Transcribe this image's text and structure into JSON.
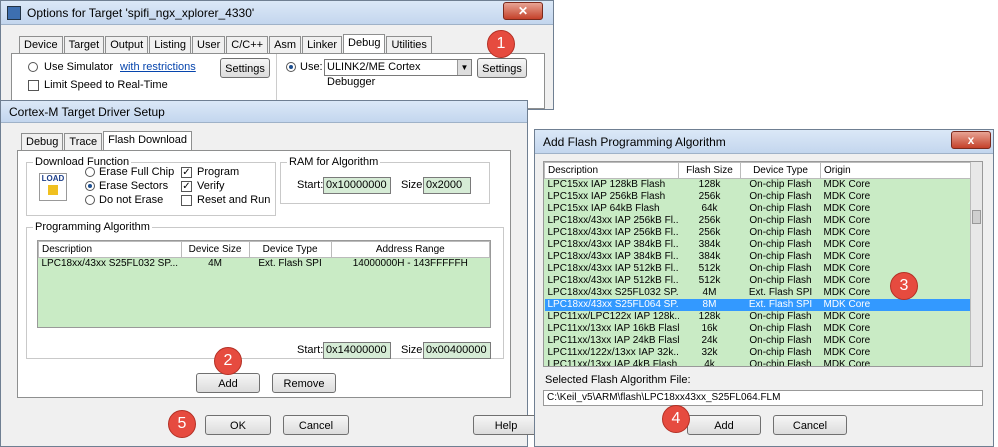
{
  "options_window": {
    "title": "Options for Target 'spifi_ngx_xplorer_4330'",
    "tabs": [
      "Device",
      "Target",
      "Output",
      "Listing",
      "User",
      "C/C++",
      "Asm",
      "Linker",
      "Debug",
      "Utilities"
    ],
    "active_tab": "Debug",
    "use_simulator_label": "Use Simulator",
    "with_restrictions_link": "with restrictions",
    "settings_left_label": "Settings",
    "limit_speed_label": "Limit Speed to Real-Time",
    "use_label": "Use:",
    "debugger_value": "ULINK2/ME Cortex Debugger",
    "settings_right_label": "Settings"
  },
  "driver_window": {
    "title": "Cortex-M Target Driver Setup",
    "tabs": [
      "Debug",
      "Trace",
      "Flash Download"
    ],
    "active_tab": "Flash Download",
    "download_function_label": "Download Function",
    "load_icon_text": "LOAD",
    "erase_full_chip": "Erase Full Chip",
    "erase_sectors": "Erase Sectors",
    "do_not_erase": "Do not Erase",
    "program": "Program",
    "verify": "Verify",
    "reset_and_run": "Reset and Run",
    "ram_label": "RAM for Algorithm",
    "ram_start_label": "Start:",
    "ram_start": "0x10000000",
    "ram_size_label": "Size:",
    "ram_size": "0x2000",
    "prog_algo_label": "Programming Algorithm",
    "columns": [
      "Description",
      "Device Size",
      "Device Type",
      "Address Range"
    ],
    "rows": [
      [
        "LPC18xx/43xx S25FL032 SP...",
        "4M",
        "Ext. Flash SPI",
        "14000000H - 143FFFFFH"
      ]
    ],
    "algo_start_label": "Start:",
    "algo_start": "0x14000000",
    "algo_size_label": "Size:",
    "algo_size": "0x00400000",
    "add_label": "Add",
    "remove_label": "Remove",
    "ok_label": "OK",
    "cancel_label": "Cancel",
    "help_label": "Help"
  },
  "add_window": {
    "title": "Add Flash Programming Algorithm",
    "columns": [
      "Description",
      "Flash Size",
      "Device Type",
      "Origin"
    ],
    "rows": [
      [
        "LPC15xx IAP 128kB Flash",
        "128k",
        "On-chip Flash",
        "MDK Core"
      ],
      [
        "LPC15xx IAP 256kB Flash",
        "256k",
        "On-chip Flash",
        "MDK Core"
      ],
      [
        "LPC15xx IAP 64kB Flash",
        "64k",
        "On-chip Flash",
        "MDK Core"
      ],
      [
        "LPC18xx/43xx IAP 256kB Fl...",
        "256k",
        "On-chip Flash",
        "MDK Core"
      ],
      [
        "LPC18xx/43xx IAP 256kB Fl...",
        "256k",
        "On-chip Flash",
        "MDK Core"
      ],
      [
        "LPC18xx/43xx IAP 384kB Fl...",
        "384k",
        "On-chip Flash",
        "MDK Core"
      ],
      [
        "LPC18xx/43xx IAP 384kB Fl...",
        "384k",
        "On-chip Flash",
        "MDK Core"
      ],
      [
        "LPC18xx/43xx IAP 512kB Fl...",
        "512k",
        "On-chip Flash",
        "MDK Core"
      ],
      [
        "LPC18xx/43xx IAP 512kB Fl...",
        "512k",
        "On-chip Flash",
        "MDK Core"
      ],
      [
        "LPC18xx/43xx S25FL032 SP...",
        "4M",
        "Ext. Flash SPI",
        "MDK Core"
      ],
      [
        "LPC18xx/43xx S25FL064 SP...",
        "8M",
        "Ext. Flash SPI",
        "MDK Core"
      ],
      [
        "LPC11xx/LPC122x IAP 128k...",
        "128k",
        "On-chip Flash",
        "MDK Core"
      ],
      [
        "LPC11xx/13xx IAP 16kB Flash",
        "16k",
        "On-chip Flash",
        "MDK Core"
      ],
      [
        "LPC11xx/13xx IAP 24kB Flash",
        "24k",
        "On-chip Flash",
        "MDK Core"
      ],
      [
        "LPC11xx/122x/13xx IAP 32k...",
        "32k",
        "On-chip Flash",
        "MDK Core"
      ],
      [
        "LPC11xx/13xx IAP 4kB Flash",
        "4k",
        "On-chip Flash",
        "MDK Core"
      ]
    ],
    "selected_index": 10,
    "selected_file_label": "Selected Flash Algorithm File:",
    "selected_file": "C:\\Keil_v5\\ARM\\flash\\LPC18xx43xx_S25FL064.FLM",
    "add_label": "Add",
    "cancel_label": "Cancel",
    "close_glyph": "x"
  },
  "markers": [
    "1",
    "2",
    "3",
    "4",
    "5"
  ]
}
